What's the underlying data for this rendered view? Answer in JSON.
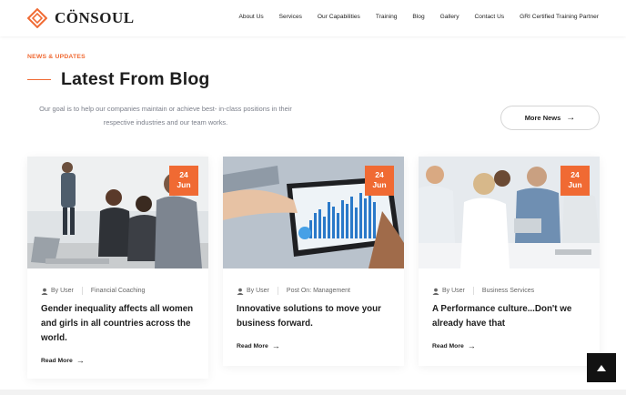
{
  "brand": {
    "name": "CÖNSOUL",
    "accent": "#f06a33"
  },
  "nav": [
    "About Us",
    "Services",
    "Our Capabilities",
    "Training",
    "Blog",
    "Gallery",
    "Contact Us",
    "GRI Certified Training Partner"
  ],
  "section": {
    "eyebrow": "NEWS & UPDATES",
    "title": "Latest From Blog",
    "subtitle": "Our goal is to help our companies maintain or achieve best- in-class positions in their respective industries and our team works.",
    "more_button": "More News"
  },
  "posts": [
    {
      "day": "24",
      "month": "Jun",
      "author": "By User",
      "category": "Financial Coaching",
      "title": "Gender inequality affects all women and girls in all countries across the world.",
      "read_more": "Read More",
      "image_icon": "business-meeting-photo"
    },
    {
      "day": "24",
      "month": "Jun",
      "author": "By User",
      "category": "Post On: Management",
      "title": "Innovative solutions to move your business forward.",
      "read_more": "Read More",
      "image_icon": "tablet-chart-photo"
    },
    {
      "day": "24",
      "month": "Jun",
      "author": "By User",
      "category": "Business Services",
      "title": "A Performance culture...Don't we already have that",
      "read_more": "Read More",
      "image_icon": "team-meeting-photo"
    }
  ],
  "scroll_top_icon": "chevron-up-icon"
}
